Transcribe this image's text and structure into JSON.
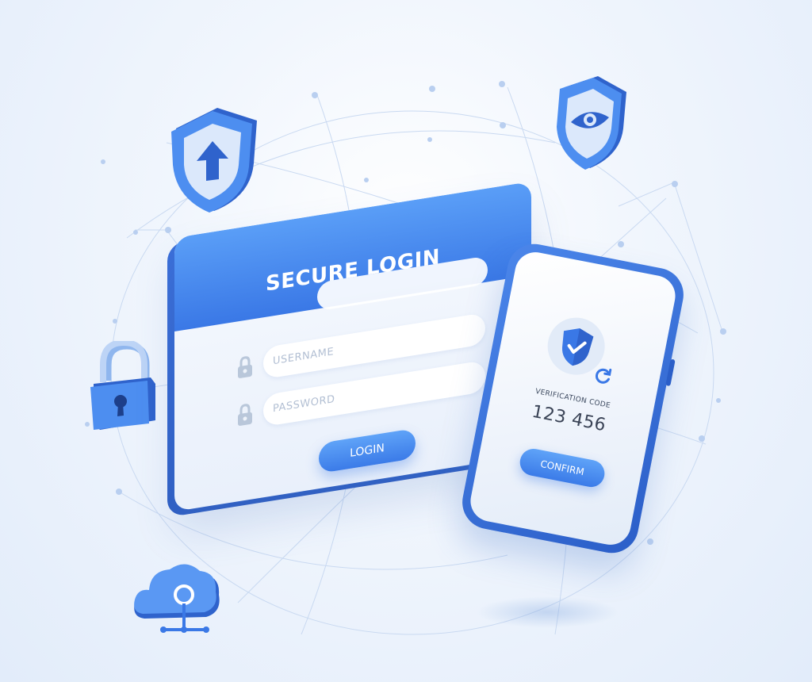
{
  "login_panel": {
    "title": "SECURE LOGIN",
    "username_placeholder": "USERNAME",
    "password_placeholder": "PASSWORD",
    "login_label": "LOGIN"
  },
  "phone": {
    "verification_label": "VERIFICATION CODE",
    "verification_code": "123 456",
    "confirm_label": "CONFIRM"
  },
  "icons": [
    "shield-upload-icon",
    "shield-eye-icon",
    "padlock-icon",
    "cloud-network-icon",
    "shield-check-icon",
    "refresh-icon",
    "lock-icon"
  ],
  "colors": {
    "accent": "#3a78e6",
    "accent_light": "#5a9ef7",
    "dark_blue": "#2b5ec8",
    "background": "#e8f0fb",
    "text_dark": "#3a4356",
    "placeholder": "#b2bfd3"
  }
}
